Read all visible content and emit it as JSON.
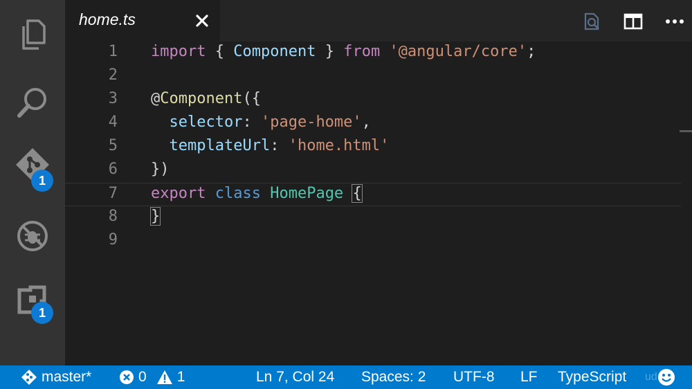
{
  "tab": {
    "title": "home.ts",
    "close_glyph": "×"
  },
  "activity_bar": {
    "items": [
      {
        "name": "explorer-icon"
      },
      {
        "name": "search-icon"
      },
      {
        "name": "source-control-icon",
        "badge": "1"
      },
      {
        "name": "debug-icon"
      },
      {
        "name": "extensions-icon",
        "badge": "1"
      }
    ]
  },
  "toolbar": {
    "icons": [
      "open-preview-icon",
      "split-editor-icon",
      "more-actions-icon"
    ]
  },
  "editor": {
    "line_numbers": [
      "1",
      "2",
      "3",
      "4",
      "5",
      "6",
      "7",
      "8",
      "9"
    ],
    "current_line": 7,
    "lines": [
      [
        {
          "t": "import",
          "c": "kw-import"
        },
        {
          "t": " { ",
          "c": "punc"
        },
        {
          "t": "Component",
          "c": "var"
        },
        {
          "t": " } ",
          "c": "punc"
        },
        {
          "t": "from",
          "c": "kw-import"
        },
        {
          "t": " ",
          "c": "punc"
        },
        {
          "t": "'@angular/core'",
          "c": "str"
        },
        {
          "t": ";",
          "c": "punc"
        }
      ],
      [],
      [
        {
          "t": "@",
          "c": "punc"
        },
        {
          "t": "Component",
          "c": "fn"
        },
        {
          "t": "({",
          "c": "punc"
        }
      ],
      [
        {
          "t": "  ",
          "c": "punc"
        },
        {
          "t": "selector",
          "c": "var"
        },
        {
          "t": ": ",
          "c": "punc"
        },
        {
          "t": "'page-home'",
          "c": "str"
        },
        {
          "t": ",",
          "c": "punc"
        }
      ],
      [
        {
          "t": "  ",
          "c": "punc"
        },
        {
          "t": "templateUrl",
          "c": "var"
        },
        {
          "t": ": ",
          "c": "punc"
        },
        {
          "t": "'home.html'",
          "c": "str"
        }
      ],
      [
        {
          "t": "})",
          "c": "punc"
        }
      ],
      [
        {
          "t": "export",
          "c": "kw-import"
        },
        {
          "t": " ",
          "c": "punc"
        },
        {
          "t": "class",
          "c": "kw-blue"
        },
        {
          "t": " ",
          "c": "punc"
        },
        {
          "t": "HomePage",
          "c": "cls"
        },
        {
          "t": " ",
          "c": "punc"
        },
        {
          "t": "{",
          "c": "punc bracket-box"
        }
      ],
      [
        {
          "t": "}",
          "c": "punc bracket-box"
        }
      ],
      []
    ]
  },
  "status_bar": {
    "branch": "master*",
    "errors": "0",
    "warnings": "1",
    "position": "Ln 7, Col 24",
    "indent": "Spaces: 2",
    "encoding": "UTF-8",
    "eol": "LF",
    "language": "TypeScript",
    "watermark": "ud",
    "feedback_icon": "smiley-icon"
  },
  "colors": {
    "status_bar_bg": "#007acc",
    "activity_bar_bg": "#333333",
    "editor_bg": "#1e1e1e",
    "badge": "#0e7ad3"
  }
}
